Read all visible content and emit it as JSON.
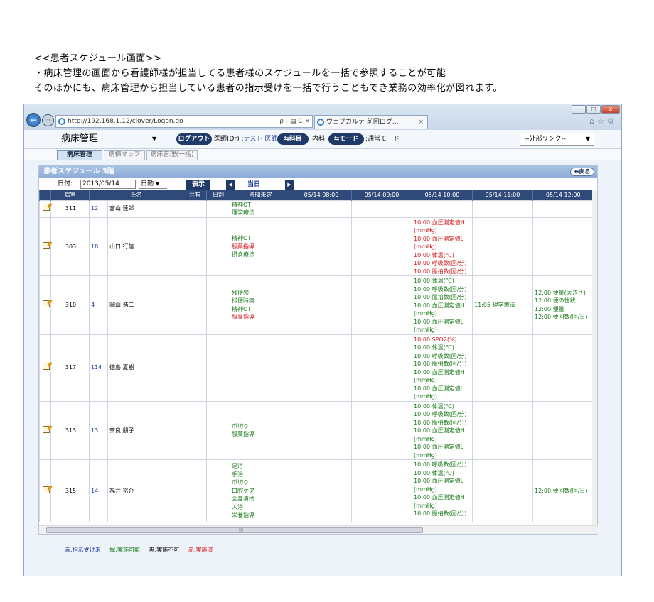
{
  "intro": {
    "line1": "<<患者スケジュール画面>>",
    "line2": "・病床管理の画面から看護師様が担当してる患者様のスケジュールを一括で参照することが可能",
    "line3": "そのほかにも、病床管理から担当している患者の指示受けを一括で行うこともでき業務の効率化が図れます。"
  },
  "browser": {
    "url": "http://192.168.1.12/clover/Logon.do",
    "addr_icons": "ρ - ▤ C ×",
    "tab_title": "ウェブカルテ 前回ログ...",
    "tab_close": "×",
    "top_icons": "⌂☆⚙",
    "win_min": "—",
    "win_max": "□",
    "win_close": "x",
    "back": "←",
    "fwd": "→"
  },
  "header": {
    "ward": "病床管理",
    "logout": "ログアウト",
    "role_label": "医師(Dr) :",
    "user": "テスト 医師",
    "dept_btn": "科目",
    "dept": ":内科",
    "mode_btn": "モード",
    "mode": ":通常モード",
    "external_links": "--外部リンク--",
    "dropdown_arrow": "▼"
  },
  "subtabs": [
    "病床管理",
    "病棟マップ",
    "病床管理(一括)"
  ],
  "panel": {
    "title": "患者スケジュール 3階",
    "return_label": "戻る",
    "date_label": "日付:",
    "date_value": "2013/05/14",
    "auto_value": "日勤",
    "show_label": "表示",
    "prev": "◀",
    "next": "▶",
    "today_label": "当日"
  },
  "table": {
    "headers": [
      "病室",
      "氏名",
      "共有",
      "日別",
      "時間未定",
      "05/14 08:00",
      "05/14 09:00",
      "05/14 10:00",
      "05/14 11:00",
      "05/14 12:00"
    ],
    "rows": [
      {
        "room": "311",
        "id": "12",
        "name": "富山 達郎",
        "undetermined": [
          {
            "t": "精神OT",
            "c": "g"
          },
          {
            "t": "理学療法",
            "c": "g"
          }
        ],
        "t10": [],
        "t11": [],
        "t12": []
      },
      {
        "room": "303",
        "id": "18",
        "name": "山口 行信",
        "undetermined": [
          {
            "t": "精神OT",
            "c": "g"
          },
          {
            "t": "服薬指導",
            "c": "r"
          },
          {
            "t": "摂食療法",
            "c": "g"
          }
        ],
        "t10": [
          {
            "t": "10:00 血圧測定値H",
            "c": "r"
          },
          {
            "t": "(mmHg)",
            "c": "r"
          },
          {
            "t": "10:00 血圧測定値L",
            "c": "r"
          },
          {
            "t": "(mmHg)",
            "c": "r"
          },
          {
            "t": "10:00 体温(℃)",
            "c": "r"
          },
          {
            "t": "10:00 呼吸数(回/分)",
            "c": "r"
          },
          {
            "t": "10:00 脈拍数(回/分)",
            "c": "r"
          }
        ],
        "t11": [],
        "t12": []
      },
      {
        "room": "310",
        "id": "4",
        "name": "岡山 浩二",
        "undetermined": [
          {
            "t": "残便感",
            "c": "g"
          },
          {
            "t": "排便時痛",
            "c": "g"
          },
          {
            "t": "精神OT",
            "c": "g"
          },
          {
            "t": "服薬指導",
            "c": "r"
          }
        ],
        "t10": [
          {
            "t": "10:00 体温(℃)",
            "c": "g"
          },
          {
            "t": "10:00 呼吸数(回/分)",
            "c": "g"
          },
          {
            "t": "10:00 脈拍数(回/分)",
            "c": "g"
          },
          {
            "t": "10:00 血圧測定値H",
            "c": "g"
          },
          {
            "t": "(mmHg)",
            "c": "g"
          },
          {
            "t": "10:00 血圧測定値L",
            "c": "g"
          },
          {
            "t": "(mmHg)",
            "c": "g"
          }
        ],
        "t11": [
          {
            "t": "11:05 理学療法",
            "c": "g"
          }
        ],
        "t12": [
          {
            "t": "12:00 便量(大きさ)",
            "c": "g"
          },
          {
            "t": "12:00 便の性状",
            "c": "g"
          },
          {
            "t": "12:00 便量",
            "c": "g"
          },
          {
            "t": "12:00 便回数(回/日)",
            "c": "g"
          }
        ]
      },
      {
        "room": "317",
        "id": "114",
        "name": "徳島 夏樹",
        "undetermined": [],
        "t10": [
          {
            "t": "10:00 SPO2(%)",
            "c": "r"
          },
          {
            "t": "10:00 体温(℃)",
            "c": "g"
          },
          {
            "t": "10:00 呼吸数(回/分)",
            "c": "g"
          },
          {
            "t": "10:00 脈拍数(回/分)",
            "c": "g"
          },
          {
            "t": "10:00 血圧測定値H",
            "c": "g"
          },
          {
            "t": "(mmHg)",
            "c": "g"
          },
          {
            "t": "10:00 血圧測定値L",
            "c": "g"
          },
          {
            "t": "(mmHg)",
            "c": "g"
          }
        ],
        "t11": [],
        "t12": []
      },
      {
        "room": "313",
        "id": "13",
        "name": "奈良 朋子",
        "undetermined": [
          {
            "t": "爪切り",
            "c": "g"
          },
          {
            "t": "服薬指導",
            "c": "g"
          }
        ],
        "t10": [
          {
            "t": "10:00 体温(℃)",
            "c": "g"
          },
          {
            "t": "10:00 呼吸数(回/分)",
            "c": "g"
          },
          {
            "t": "10:00 脈拍数(回/分)",
            "c": "g"
          },
          {
            "t": "10:00 血圧測定値H",
            "c": "g"
          },
          {
            "t": "(mmHg)",
            "c": "g"
          },
          {
            "t": "10:00 血圧測定値L",
            "c": "g"
          },
          {
            "t": "(mmHg)",
            "c": "g"
          }
        ],
        "t11": [],
        "t12": []
      },
      {
        "room": "315",
        "id": "14",
        "name": "福井 裕介",
        "undetermined": [
          {
            "t": "足浴",
            "c": "g"
          },
          {
            "t": "手浴",
            "c": "g"
          },
          {
            "t": "爪切り",
            "c": "g"
          },
          {
            "t": "口腔ケア",
            "c": "g"
          },
          {
            "t": "全身清拭",
            "c": "g"
          },
          {
            "t": "入浴",
            "c": "g"
          },
          {
            "t": "栄養指導",
            "c": "g"
          }
        ],
        "t10": [
          {
            "t": "10:00 呼吸数(回/分)",
            "c": "g"
          },
          {
            "t": "10:00 体温(℃)",
            "c": "g"
          },
          {
            "t": "10:00 血圧測定値L",
            "c": "g"
          },
          {
            "t": "(mmHg)",
            "c": "g"
          },
          {
            "t": "10:00 血圧測定値H",
            "c": "g"
          },
          {
            "t": "(mmHg)",
            "c": "g"
          },
          {
            "t": "10:00 脈拍数(回/分)",
            "c": "g"
          }
        ],
        "t11": [],
        "t12": [
          {
            "t": "12:00 便回数(回/日)",
            "c": "g"
          }
        ]
      }
    ]
  },
  "legend": [
    {
      "t": "青:指示受け未",
      "color": "#1a3ca0"
    },
    {
      "t": "緑:実施可能",
      "color": "#1a7a1a"
    },
    {
      "t": "黒:実施不可",
      "color": "#000000"
    },
    {
      "t": "赤:実施済",
      "color": "#d21a1a"
    }
  ]
}
